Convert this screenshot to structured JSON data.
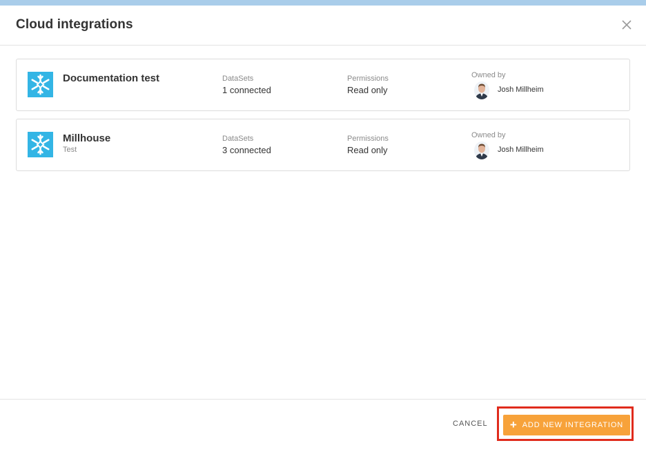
{
  "dialog": {
    "title": "Cloud integrations",
    "close_icon": "close-icon"
  },
  "integrations": [
    {
      "logo_icon": "snowflake-icon",
      "name": "Documentation test",
      "description": "",
      "datasets_label": "DataSets",
      "datasets_value": "1 connected",
      "permissions_label": "Permissions",
      "permissions_value": "Read only",
      "owner_label": "Owned by",
      "owner_name": "Josh Millheim"
    },
    {
      "logo_icon": "snowflake-icon",
      "name": "Millhouse",
      "description": "Test",
      "datasets_label": "DataSets",
      "datasets_value": "3 connected",
      "permissions_label": "Permissions",
      "permissions_value": "Read only",
      "owner_label": "Owned by",
      "owner_name": "Josh Millheim"
    }
  ],
  "footer": {
    "cancel_label": "CANCEL",
    "add_label": "ADD NEW INTEGRATION",
    "add_icon": "plus-icon"
  },
  "colors": {
    "accent": "#f7a23a",
    "logo_bg": "#33b5e5",
    "highlight": "#e02b1c",
    "top_strip": "#a9cdea"
  }
}
